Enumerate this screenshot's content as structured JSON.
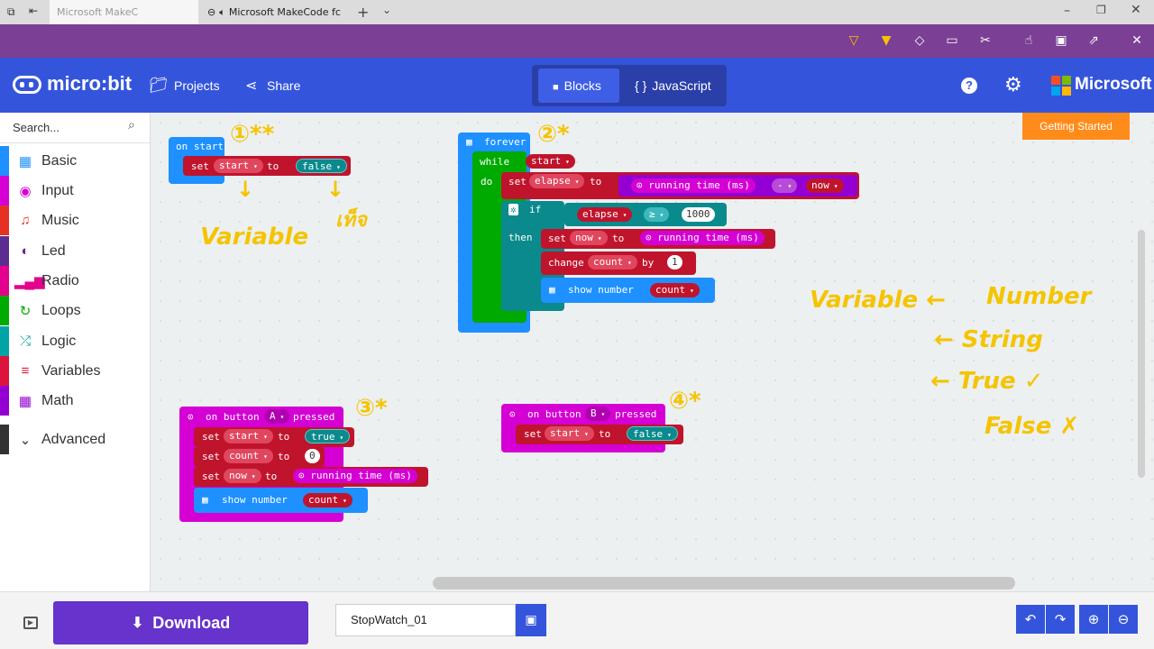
{
  "browser": {
    "tab1_title": "Microsoft MakeC",
    "tab2_title": "Microsoft MakeCode fc",
    "new_tab_label": "+"
  },
  "header": {
    "logo_text": "micro:bit",
    "projects_label": "Projects",
    "share_label": "Share",
    "blocks_label": "Blocks",
    "javascript_label": "JavaScript",
    "brand_label": "Microsoft"
  },
  "sidebar": {
    "search_placeholder": "Search...",
    "items": [
      {
        "label": "Basic",
        "color": "#1e90ff",
        "icon": "grid-icon"
      },
      {
        "label": "Input",
        "color": "#d400d4",
        "icon": "target-icon"
      },
      {
        "label": "Music",
        "color": "#e63022",
        "icon": "headphones-icon"
      },
      {
        "label": "Led",
        "color": "#5c2d91",
        "icon": "toggle-icon"
      },
      {
        "label": "Radio",
        "color": "#e3008c",
        "icon": "signal-icon"
      },
      {
        "label": "Loops",
        "color": "#00aa00",
        "icon": "refresh-icon"
      },
      {
        "label": "Logic",
        "color": "#00a4a6",
        "icon": "shuffle-icon"
      },
      {
        "label": "Variables",
        "color": "#dc143c",
        "icon": "list-icon"
      },
      {
        "label": "Math",
        "color": "#9400d3",
        "icon": "calculator-icon"
      },
      {
        "label": "Advanced",
        "color": "#333333",
        "icon": "chevron-down-icon"
      }
    ]
  },
  "workspace": {
    "getting_started_label": "Getting Started",
    "on_start": {
      "header": "on start",
      "set": "set",
      "var": "start",
      "to": "to",
      "value": "false"
    },
    "forever": {
      "header": "forever",
      "while": "while",
      "while_var": "start",
      "do": "do",
      "set1": "set",
      "set1_var": "elapse",
      "set1_to": "to",
      "running_time": "running time (ms)",
      "minus": "-",
      "now_var": "now",
      "if": "if",
      "if_var": "elapse",
      "op": "≥",
      "threshold": "1000",
      "then": "then",
      "set2": "set",
      "set2_var": "now",
      "set2_to": "to",
      "running_time2": "running time (ms)",
      "change": "change",
      "change_var": "count",
      "by": "by",
      "change_val": "1",
      "show_number": "show number",
      "show_var": "count"
    },
    "button_a": {
      "on": "on button",
      "button": "A",
      "pressed": "pressed",
      "set1": "set",
      "set1_var": "start",
      "to": "to",
      "set1_val": "true",
      "set2": "set",
      "set2_var": "count",
      "set2_val": "0",
      "set3": "set",
      "set3_var": "now",
      "running_time": "running time (ms)",
      "show_number": "show number",
      "show_var": "count"
    },
    "button_b": {
      "on": "on button",
      "button": "B",
      "pressed": "pressed",
      "set": "set",
      "var": "start",
      "to": "to",
      "value": "false"
    },
    "annotations": {
      "a1": "①**",
      "variable1": "Variable",
      "false_thai": "เท็จ",
      "a2": "②*",
      "a3": "③*",
      "a4": "④*",
      "variable2": "Variable ←",
      "number": "Number",
      "string": "← String",
      "true": "← True ✓",
      "false": "False ✗"
    }
  },
  "footer": {
    "download_label": "Download",
    "project_name": "StopWatch_01"
  }
}
